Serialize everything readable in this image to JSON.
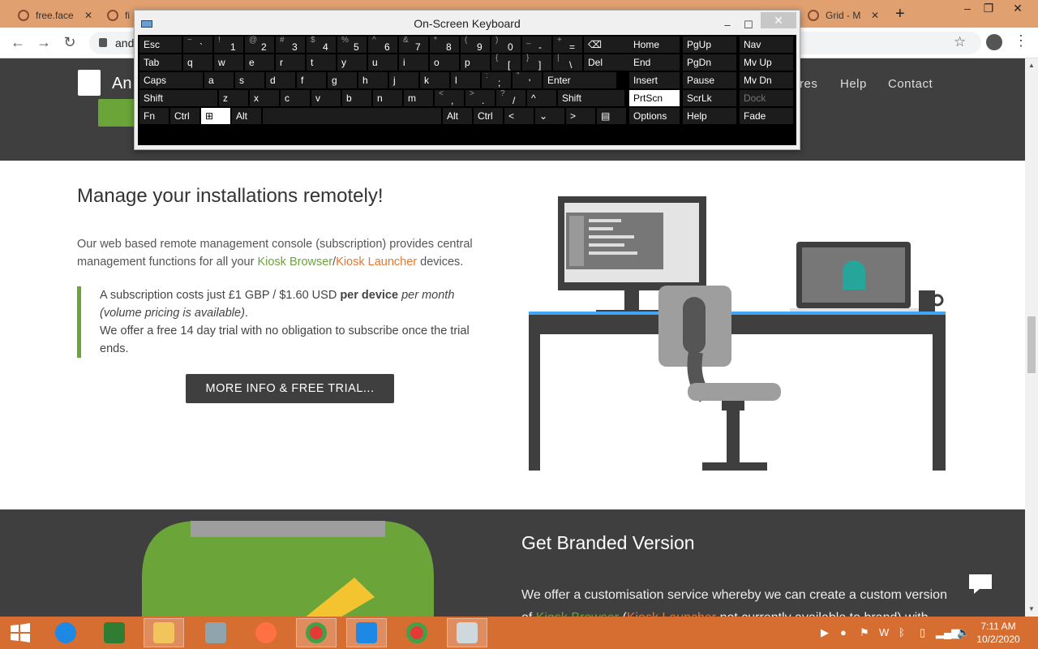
{
  "browser": {
    "tabs": [
      {
        "label": "free.face"
      },
      {
        "label": "fi"
      },
      {
        "label": "Grid - M"
      }
    ],
    "url": "and",
    "new_tab": "+",
    "win_min": "–",
    "win_max": "❐",
    "win_close": "✕"
  },
  "site": {
    "logo_text": "An",
    "nav": [
      "res",
      "Help",
      "Contact"
    ]
  },
  "section1": {
    "title": "Manage your installations remotely!",
    "para_a": "Our web based remote management console (subscription) provides central management functions for all your ",
    "link_browser": "Kiosk Browser",
    "slash": "/",
    "link_launcher": "Kiosk Launcher",
    "para_b": " devices.",
    "quote_a": "A subscription costs just £1 GBP / $1.60 USD ",
    "quote_bold": "per device",
    "quote_italic": " per month (volume pricing is available)",
    "quote_dot": ".",
    "quote_b": "We offer a free 14 day trial with no obligation to subscribe once the trial ends.",
    "button": "MORE INFO & FREE TRIAL..."
  },
  "section2": {
    "title": "Get Branded Version",
    "para": "We offer a customisation service whereby we can create a custom version",
    "para2_a": "of ",
    "link_browser": "Kiosk Browser",
    "para2_b": " (",
    "link_launcher": "Kiosk Launcher",
    "para2_c": " not currently available to brand) with"
  },
  "osk": {
    "title": "On-Screen Keyboard",
    "min": "–",
    "max": "☐",
    "close": "✕",
    "rows": [
      [
        {
          "label": "Esc"
        },
        {
          "sup": "~",
          "main": "`"
        },
        {
          "sup": "!",
          "main": "1"
        },
        {
          "sup": "@",
          "main": "2"
        },
        {
          "sup": "#",
          "main": "3"
        },
        {
          "sup": "$",
          "main": "4"
        },
        {
          "sup": "%",
          "main": "5"
        },
        {
          "sup": "^",
          "main": "6"
        },
        {
          "sup": "&",
          "main": "7"
        },
        {
          "sup": "*",
          "main": "8"
        },
        {
          "sup": "(",
          "main": "9"
        },
        {
          "sup": ")",
          "main": "0"
        },
        {
          "sup": "_",
          "main": "-"
        },
        {
          "sup": "+",
          "main": "="
        },
        {
          "label": "⌫"
        }
      ],
      [
        {
          "label": "Tab"
        },
        {
          "label": "q"
        },
        {
          "label": "w"
        },
        {
          "label": "e"
        },
        {
          "label": "r"
        },
        {
          "label": "t"
        },
        {
          "label": "y"
        },
        {
          "label": "u"
        },
        {
          "label": "i"
        },
        {
          "label": "o"
        },
        {
          "label": "p"
        },
        {
          "sup": "{",
          "main": "["
        },
        {
          "sup": "}",
          "main": "]"
        },
        {
          "sup": "|",
          "main": "\\"
        },
        {
          "label": "Del"
        }
      ],
      [
        {
          "label": "Caps"
        },
        {
          "label": "a"
        },
        {
          "label": "s"
        },
        {
          "label": "d"
        },
        {
          "label": "f"
        },
        {
          "label": "g"
        },
        {
          "label": "h"
        },
        {
          "label": "j"
        },
        {
          "label": "k"
        },
        {
          "label": "l"
        },
        {
          "sup": ":",
          "main": ";"
        },
        {
          "sup": "\"",
          "main": "'"
        },
        {
          "label": "Enter"
        }
      ],
      [
        {
          "label": "Shift"
        },
        {
          "label": "z"
        },
        {
          "label": "x"
        },
        {
          "label": "c"
        },
        {
          "label": "v"
        },
        {
          "label": "b"
        },
        {
          "label": "n"
        },
        {
          "label": "m"
        },
        {
          "sup": "<",
          "main": ","
        },
        {
          "sup": ">",
          "main": "."
        },
        {
          "sup": "?",
          "main": "/"
        },
        {
          "label": "^"
        },
        {
          "label": "Shift"
        }
      ],
      [
        {
          "label": "Fn"
        },
        {
          "label": "Ctrl"
        },
        {
          "label": "⊞"
        },
        {
          "label": "Alt"
        },
        {
          "label": ""
        },
        {
          "label": "Alt"
        },
        {
          "label": "Ctrl"
        },
        {
          "label": "<"
        },
        {
          "label": "⌄"
        },
        {
          "label": ">"
        },
        {
          "label": "▤"
        }
      ]
    ],
    "nav_rows": [
      [
        "Home",
        "PgUp",
        "Nav"
      ],
      [
        "End",
        "PgDn",
        "Mv Up"
      ],
      [
        "Insert",
        "Pause",
        "Mv Dn"
      ],
      [
        "PrtScn",
        "ScrLk",
        "Dock"
      ],
      [
        "Options",
        "Help",
        "Fade"
      ]
    ],
    "selected_key": "PrtScn",
    "disabled_key": "Dock"
  },
  "taskbar": {
    "apps": [
      "start-button",
      "internet-explorer-icon",
      "store-icon",
      "file-explorer-icon",
      "calculator-icon",
      "firefox-icon",
      "chrome-icon",
      "vscode-icon",
      "chrome-icon",
      "on-screen-keyboard-icon"
    ],
    "time": "7:11 AM",
    "date": "10/2/2020"
  }
}
